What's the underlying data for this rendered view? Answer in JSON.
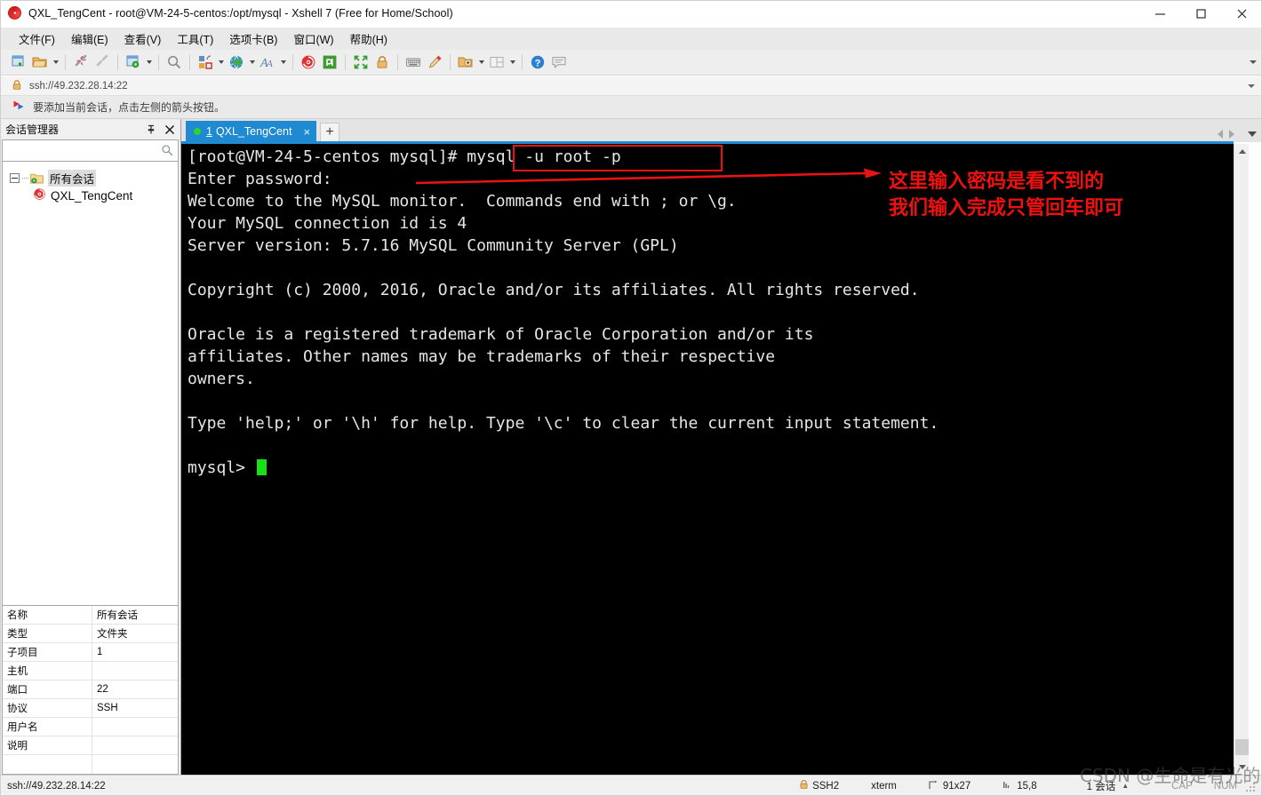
{
  "window": {
    "title": "QXL_TengCent - root@VM-24-5-centos:/opt/mysql - Xshell 7 (Free for Home/School)",
    "app_icon": "xshell-spiral-icon",
    "minimize_label": "—",
    "maximize_label": "□",
    "close_label": "✕"
  },
  "menubar": {
    "items": [
      {
        "label": "文件(F)",
        "name": "menu-file"
      },
      {
        "label": "编辑(E)",
        "name": "menu-edit"
      },
      {
        "label": "查看(V)",
        "name": "menu-view"
      },
      {
        "label": "工具(T)",
        "name": "menu-tools"
      },
      {
        "label": "选项卡(B)",
        "name": "menu-tabs"
      },
      {
        "label": "窗口(W)",
        "name": "menu-window"
      },
      {
        "label": "帮助(H)",
        "name": "menu-help"
      }
    ]
  },
  "toolbar": {
    "icons": [
      "new-session-icon",
      "open-folder-icon",
      "connect-icon",
      "disconnect-icon",
      "session-properties-icon",
      "find-icon",
      "transfer-icon",
      "globe-icon",
      "font-icon",
      "xshell-icon",
      "xftp-icon",
      "fullscreen-icon",
      "lock-icon",
      "keyboard-icon",
      "highlight-icon",
      "add-folder-icon",
      "layout-icon",
      "help-icon",
      "comment-icon"
    ]
  },
  "addressbar": {
    "lock_icon": "lock-icon",
    "url": "ssh://49.232.28.14:22"
  },
  "hintbar": {
    "icon": "red-blue-flag-icon",
    "text": "要添加当前会话，点击左侧的箭头按钮。"
  },
  "sidebar": {
    "title": "会话管理器",
    "pin_icon": "pin-icon",
    "close_icon": "close-icon",
    "search_placeholder": "",
    "search_value": "",
    "search_icon": "search-icon",
    "tree": [
      {
        "label": "所有会话",
        "name": "tree-node-all-sessions",
        "icon": "folder-icon",
        "selected": true
      },
      {
        "label": "QXL_TengCent",
        "name": "tree-node-qxl-tengcent",
        "icon": "xshell-session-icon",
        "selected": false
      }
    ],
    "properties": [
      {
        "key": "名称",
        "value": "所有会话"
      },
      {
        "key": "类型",
        "value": "文件夹"
      },
      {
        "key": "子项目",
        "value": "1"
      },
      {
        "key": "主机",
        "value": ""
      },
      {
        "key": "端口",
        "value": "22"
      },
      {
        "key": "协议",
        "value": "SSH"
      },
      {
        "key": "用户名",
        "value": ""
      },
      {
        "key": "说明",
        "value": ""
      },
      {
        "key": "",
        "value": ""
      }
    ]
  },
  "tabs": {
    "items": [
      {
        "number": "1",
        "label": "QXL_TengCent",
        "status": "connected",
        "close_label": "×",
        "active": true
      }
    ],
    "new_tab_label": "+",
    "nav_prev_icon": "chevron-left-icon",
    "nav_next_icon": "chevron-right-icon",
    "nav_list_icon": "chevron-down-icon"
  },
  "terminal": {
    "lines": [
      "[root@VM-24-5-centos mysql]# mysql -u root -p",
      "Enter password:",
      "Welcome to the MySQL monitor.  Commands end with ; or \\g.",
      "Your MySQL connection id is 4",
      "Server version: 5.7.16 MySQL Community Server (GPL)",
      "",
      "Copyright (c) 2000, 2016, Oracle and/or its affiliates. All rights reserved.",
      "",
      "Oracle is a registered trademark of Oracle Corporation and/or its",
      "affiliates. Other names may be trademarks of their respective",
      "owners.",
      "",
      "Type 'help;' or '\\h' for help. Type '\\c' to clear the current input statement.",
      "",
      "mysql> "
    ],
    "prompt": "mysql> ",
    "cursor_color": "#17e017",
    "text_color": "#e6e6e6",
    "background_color": "#000000"
  },
  "annotations": {
    "highlight_box_target": "mysql -u root -p",
    "box_color": "#e81414",
    "arrow_color": "#e81414",
    "text_line1": "这里输入密码是看不到的",
    "text_line2": "我们输入完成只管回车即可",
    "text_color": "#f01010"
  },
  "statusbar": {
    "left_text": "ssh://49.232.28.14:22",
    "protocol_icon": "lock-icon",
    "protocol": "SSH2",
    "terminal_type": "xterm",
    "size_icon": "resize-icon",
    "size": "91x27",
    "cursor_icon": "cursor-pos-icon",
    "cursor_pos": "15,8",
    "sessions": "1 会话",
    "sessions_caret": "▲",
    "caps": "CAP",
    "num": "NUM"
  },
  "watermark": {
    "text": "CSDN @生命是有光的"
  }
}
